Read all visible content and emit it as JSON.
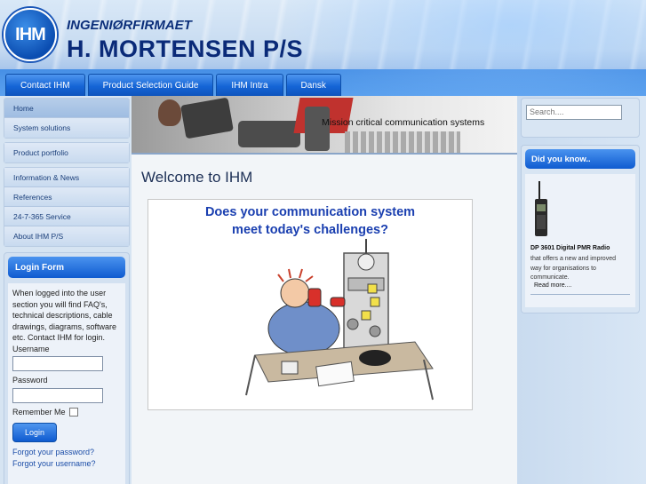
{
  "header": {
    "logo_text": "IHM",
    "company_sub": "INGENIØRFIRMAET",
    "company_main": "H. MORTENSEN P/S"
  },
  "topnav": [
    "Contact IHM",
    "Product Selection Guide",
    "IHM Intra",
    "Dansk"
  ],
  "menu": {
    "group1": [
      "Home",
      "System solutions"
    ],
    "group2": [
      "Product portfolio"
    ],
    "group3": [
      "Information & News",
      "References",
      "24-7-365 Service",
      "About IHM P/S"
    ]
  },
  "login": {
    "title": "Login Form",
    "intro": "When logged into the user section you will find FAQ's, technical descriptions, cable drawings, diagrams, software etc. Contact IHM for login.",
    "username_label": "Username",
    "password_label": "Password",
    "remember_label": "Remember Me",
    "button": "Login",
    "forgot_password": "Forgot your password?",
    "forgot_username": "Forgot your username?"
  },
  "banner": {
    "text": "Mission critical communication systems"
  },
  "main": {
    "title": "Welcome to IHM",
    "hero_line1": "Does your communication system",
    "hero_line2": "meet today's challenges?"
  },
  "search": {
    "placeholder": "Search...."
  },
  "did_you_know": {
    "title": "Did you know..",
    "product_name": "DP 3601 Digital PMR Radio",
    "description": "that offers a new and improved way for organisations to communicate.",
    "read_more": "Read more...."
  }
}
